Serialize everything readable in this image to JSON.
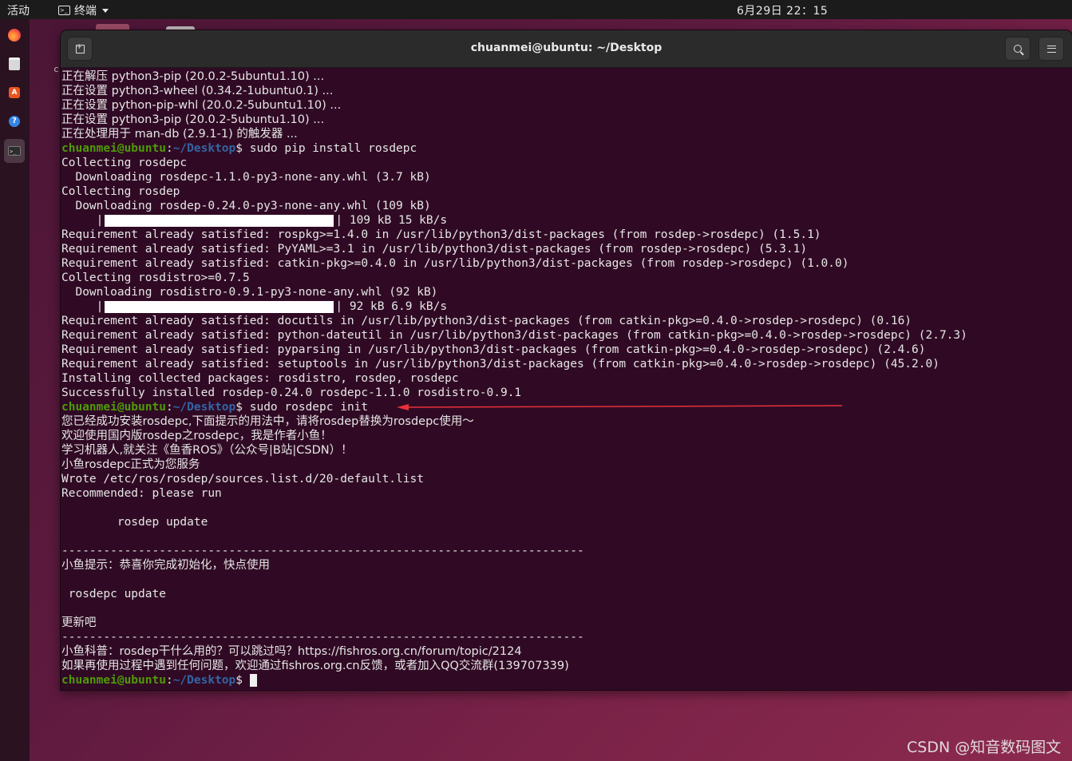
{
  "topbar": {
    "activities": "活动",
    "app_menu": "终端",
    "clock": "6月29日  22：15"
  },
  "dock": {
    "items": [
      {
        "icon": "firefox-icon"
      },
      {
        "icon": "files-icon"
      },
      {
        "icon": "software-icon"
      },
      {
        "icon": "help-icon"
      },
      {
        "icon": "terminal-icon",
        "active": true
      }
    ]
  },
  "window": {
    "title": "chuanmei@ubuntu: ~/Desktop"
  },
  "terminal": {
    "user": "chuanmei@ubuntu",
    "path": "~/Desktop",
    "lines": [
      "正在解压 python3-pip (20.0.2-5ubuntu1.10) ...",
      "正在设置 python3-wheel (0.34.2-1ubuntu0.1) ...",
      "正在设置 python-pip-whl (20.0.2-5ubuntu1.10) ...",
      "正在设置 python3-pip (20.0.2-5ubuntu1.10) ...",
      "正在处理用于 man-db (2.9.1-1) 的触发器 ...",
      "sudo pip install rosdepc",
      "Collecting rosdepc",
      "  Downloading rosdepc-1.1.0-py3-none-any.whl (3.7 kB)",
      "Collecting rosdep",
      "  Downloading rosdep-0.24.0-py3-none-any.whl (109 kB)",
      "| 109 kB 15 kB/s",
      "Requirement already satisfied: rospkg>=1.4.0 in /usr/lib/python3/dist-packages (from rosdep->rosdepc) (1.5.1)",
      "Requirement already satisfied: PyYAML>=3.1 in /usr/lib/python3/dist-packages (from rosdep->rosdepc) (5.3.1)",
      "Requirement already satisfied: catkin-pkg>=0.4.0 in /usr/lib/python3/dist-packages (from rosdep->rosdepc) (1.0.0)",
      "Collecting rosdistro>=0.7.5",
      "  Downloading rosdistro-0.9.1-py3-none-any.whl (92 kB)",
      "| 92 kB 6.9 kB/s",
      "Requirement already satisfied: docutils in /usr/lib/python3/dist-packages (from catkin-pkg>=0.4.0->rosdep->rosdepc) (0.16)",
      "Requirement already satisfied: python-dateutil in /usr/lib/python3/dist-packages (from catkin-pkg>=0.4.0->rosdep->rosdepc) (2.7.3)",
      "Requirement already satisfied: pyparsing in /usr/lib/python3/dist-packages (from catkin-pkg>=0.4.0->rosdep->rosdepc) (2.4.6)",
      "Requirement already satisfied: setuptools in /usr/lib/python3/dist-packages (from catkin-pkg>=0.4.0->rosdep->rosdepc) (45.2.0)",
      "Installing collected packages: rosdistro, rosdep, rosdepc",
      "Successfully installed rosdep-0.24.0 rosdepc-1.1.0 rosdistro-0.9.1",
      "sudo rosdepc init",
      "您已经成功安装rosdepc,下面提示的用法中，请将rosdep替换为rosdepc使用～",
      "欢迎使用国内版rosdep之rosdepc，我是作者小鱼！",
      "学习机器人,就关注《鱼香ROS》（公众号|B站|CSDN）！",
      "小鱼rosdepc正式为您服务",
      "Wrote /etc/ros/rosdep/sources.list.d/20-default.list",
      "Recommended: please run",
      "",
      "        rosdep update",
      "",
      "---------------------------------------------------------------------------",
      "小鱼提示：恭喜你完成初始化，快点使用",
      "",
      " rosdepc update",
      "",
      "更新吧",
      "---------------------------------------------------------------------------",
      "小鱼科普：rosdep干什么用的？可以跳过吗？https://fishros.org.cn/forum/topic/2124",
      "如果再使用过程中遇到任何问题，欢迎通过fishros.org.cn反馈，或者加入QQ交流群(139707339)",
      ""
    ]
  },
  "annotation_color": "#e8303a",
  "watermark": "CSDN @知音数码图文"
}
